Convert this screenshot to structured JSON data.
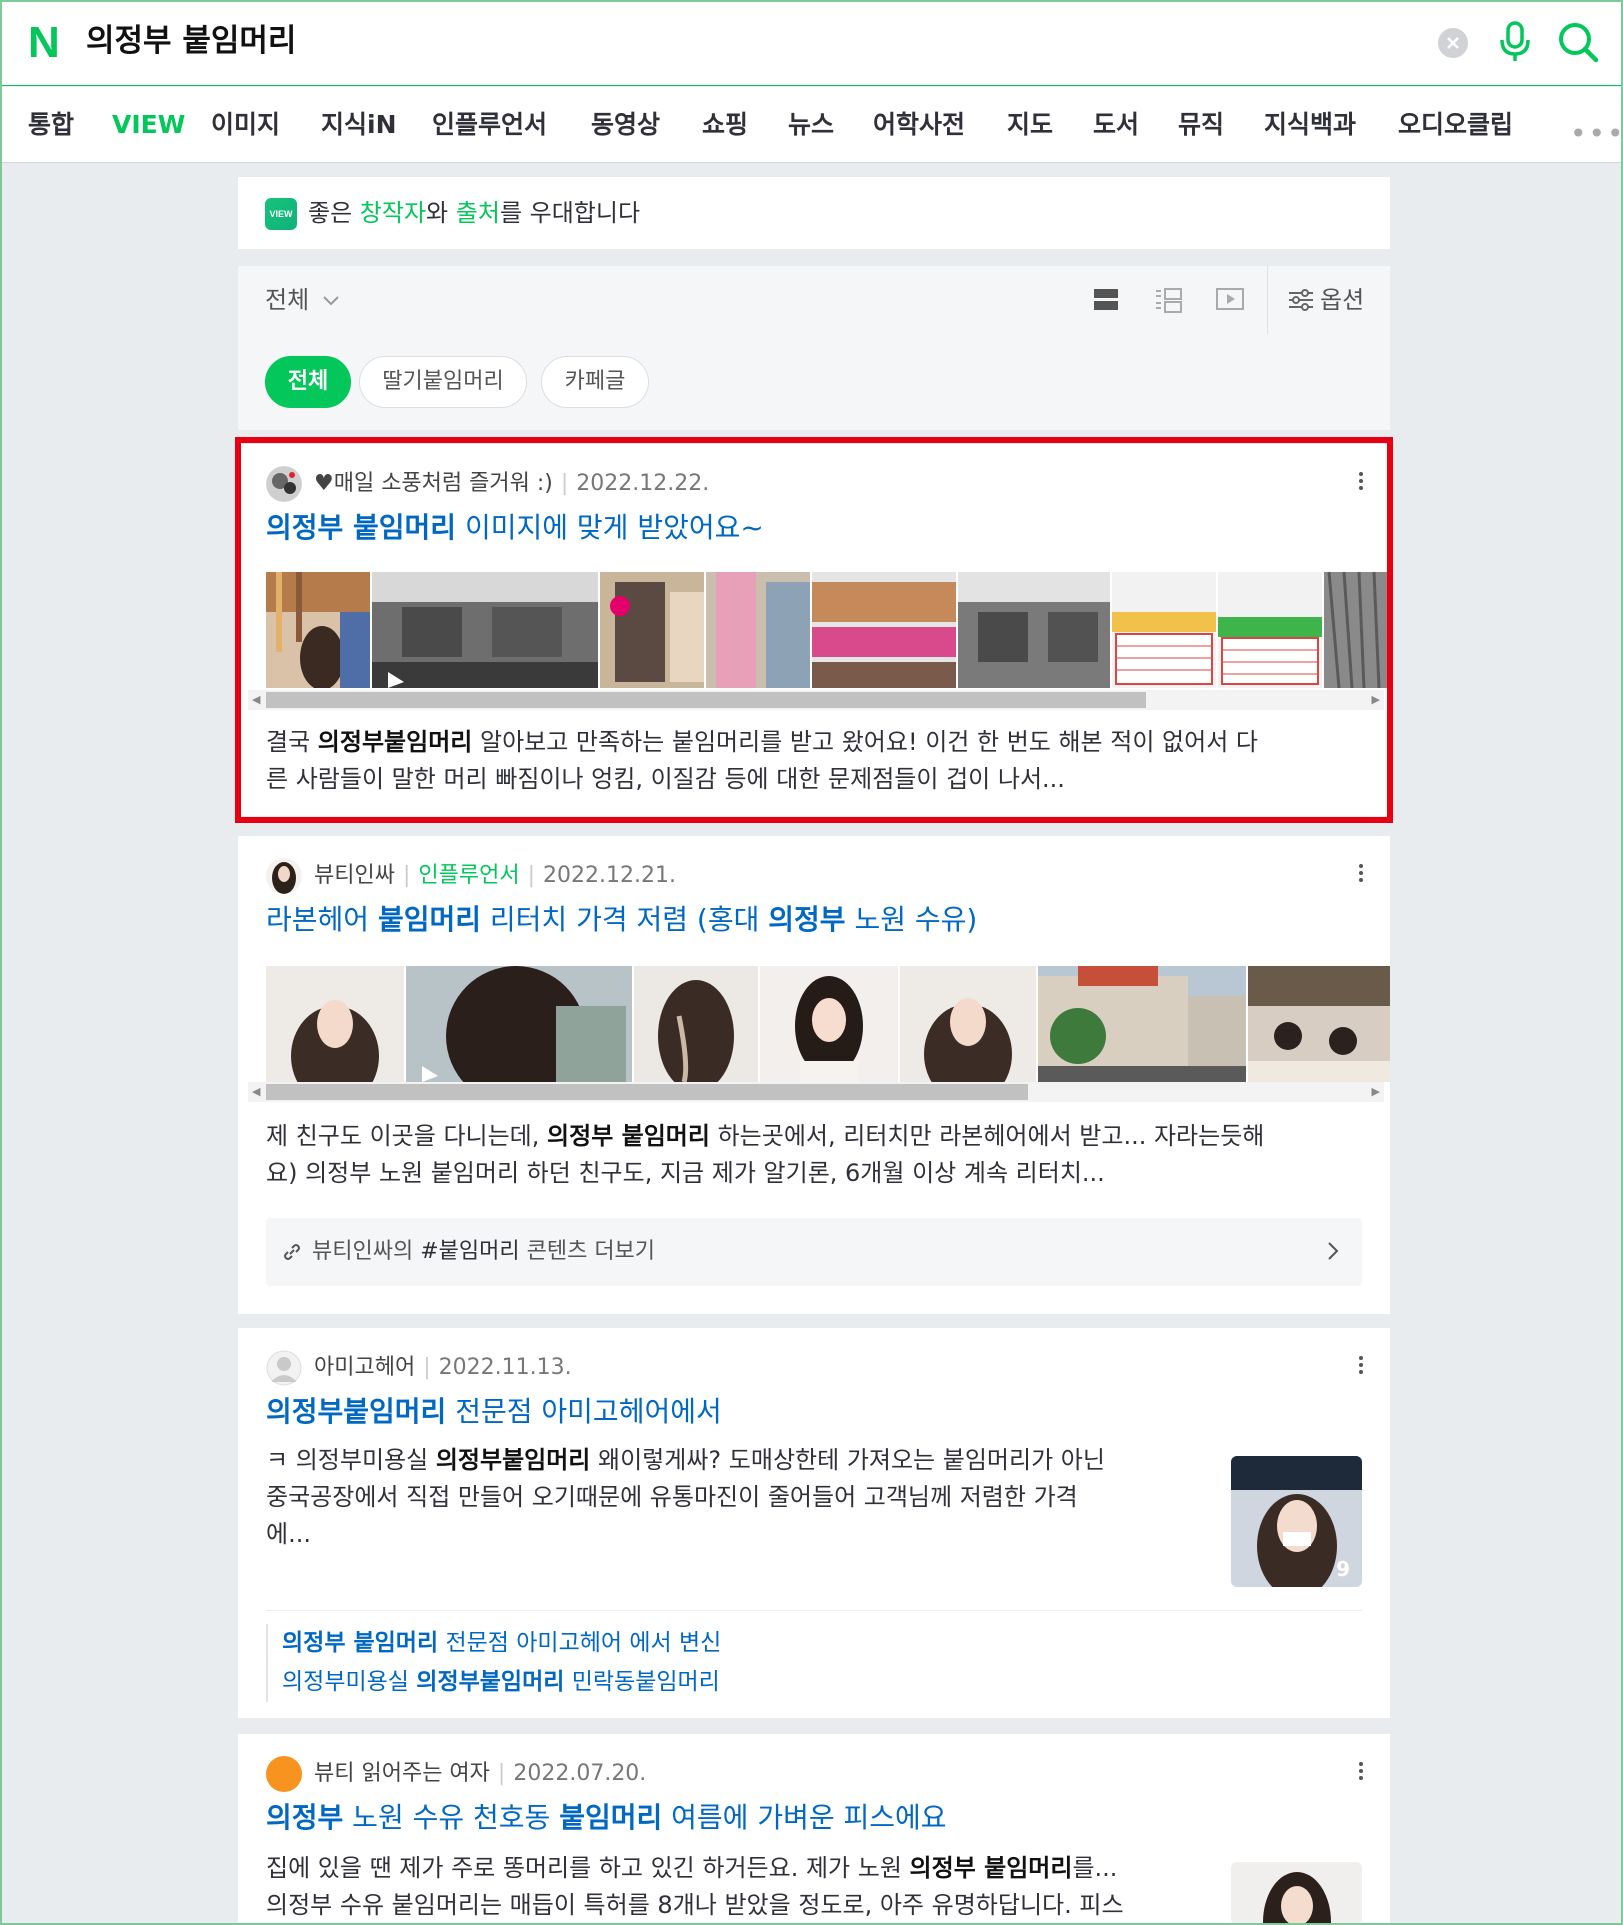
{
  "header": {
    "logo": "N",
    "query": "의정부 붙임머리"
  },
  "tabs": [
    "통합",
    "VIEW",
    "이미지",
    "지식iN",
    "인플루언서",
    "동영상",
    "쇼핑",
    "뉴스",
    "어학사전",
    "지도",
    "도서",
    "뮤직",
    "지식백과",
    "오디오클립"
  ],
  "tabs_active": "VIEW",
  "tabs_more": "•••",
  "banner": {
    "badge": "VIEW",
    "text_1": "좋은 ",
    "creator": "창작자",
    "text_2": "와 ",
    "source": "출처",
    "text_3": "를 우대합니다"
  },
  "filter": {
    "scope": "전체",
    "options_label": "옵션",
    "chips": [
      "전체",
      "딸기붙임머리",
      "카페글"
    ]
  },
  "results": [
    {
      "author": "♥매일 소풍처럼 즐거워 :)",
      "date": "2022.12.22.",
      "title_bold": "의정부 붙임머리",
      "title_rest": " 이미지에 맞게 받았어요~",
      "desc_1": "결국 ",
      "desc_bold": "의정부붙임머리",
      "desc_2": " 알아보고 만족하는 붙임머리를 받고 왔어요! 이건 한 번도 해본 적이 없어서 다",
      "desc_line2": "른 사람들이 말한 머리 빠짐이나 엉킴, 이질감 등에 대한 문제점들이 겁이 나서..."
    },
    {
      "author": "뷰티인싸",
      "badge": "인플루언서",
      "date": "2022.12.21.",
      "title_1": "라본헤어 ",
      "title_b1": "붙임머리",
      "title_2": " 리터치 가격 저렴 (홍대 ",
      "title_b2": "의정부",
      "title_3": " 노원 수유)",
      "desc_1": "제 친구도 이곳을 다니는데, ",
      "desc_bold": "의정부 붙임머리",
      "desc_2": " 하는곳에서, 리터치만 라본헤어에서 받고... 자라는듯해",
      "desc_line2": "요) 의정부 노원 붙임머리 하던 친구도, 지금 제가 알기론, 6개월 이상 계속 리터치...",
      "more_1": "뷰티인싸의 ",
      "more_tag": "#붙임머리",
      "more_2": " 콘텐츠 더보기"
    },
    {
      "author": "아미고헤어",
      "date": "2022.11.13.",
      "title_bold": "의정부붙임머리",
      "title_rest": " 전문점 아미고헤어에서",
      "desc_1": "ㅋ 의정부미용실 ",
      "desc_bold": "의정부붙임머리",
      "desc_2": " 왜이렇게싸? 도매상한테 가져오는 붙임머리가 아닌",
      "desc_line2": "중국공장에서 직접 만들어 오기때문에 유통마진이 줄어들어 고객님께 저렴한 가격",
      "desc_line3": "에...",
      "thumb_count": "9",
      "sub1_bold": "의정부 붙임머리",
      "sub1_rest": " 전문점 아미고헤어 에서 변신",
      "sub2_1": "의정부미용실 ",
      "sub2_bold": "의정부붙임머리",
      "sub2_2": " 민락동붙임머리"
    },
    {
      "author": "뷰티 읽어주는 여자",
      "date": "2022.07.20.",
      "title_b1": "의정부",
      "title_1": " 노원 수유 천호동 ",
      "title_b2": "붙임머리",
      "title_2": " 여름에 가벼운 피스에요",
      "desc_1": "집에 있을 땐 제가 주로 똥머리를 하고 있긴 하거든요. 제가 노원 ",
      "desc_bold": "의정부 붙임머리",
      "desc_2": "를...",
      "desc_line2": "의정부 수유 붙임머리는 매듭이 특허를 8개나 받았을 정도로, 아주 유명하답니다. 피스"
    }
  ],
  "colors": {
    "brand_green": "#03c75a",
    "link_blue": "#0068c3",
    "highlight_red": "#e60012"
  }
}
